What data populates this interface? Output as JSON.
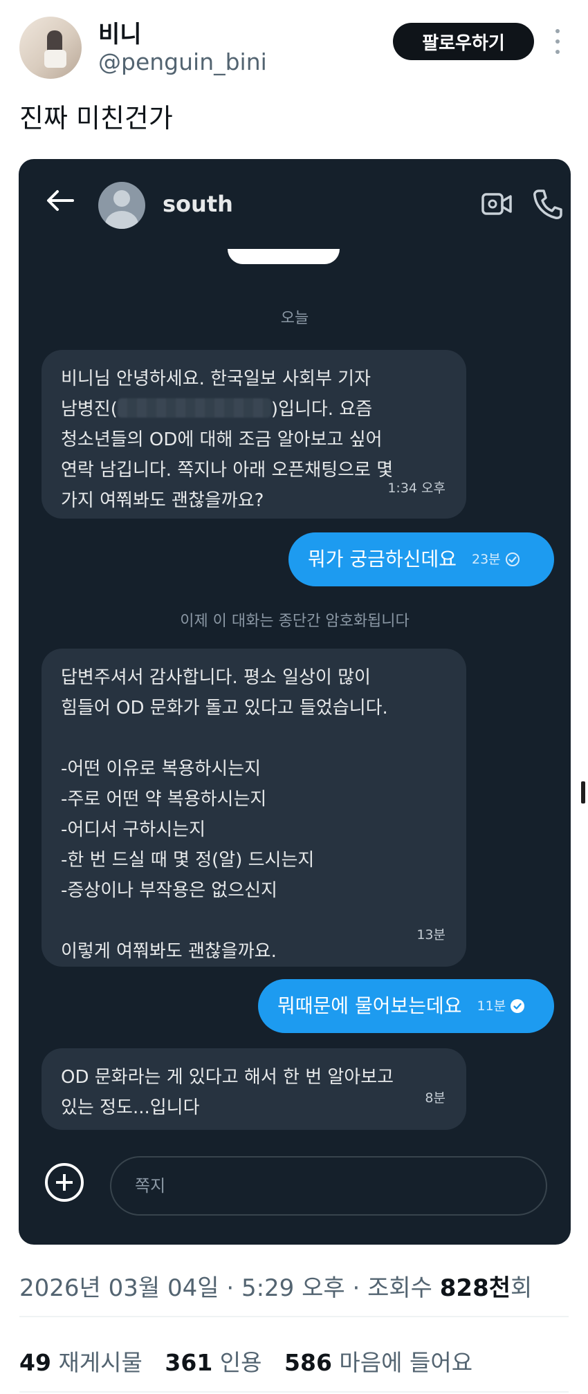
{
  "tweet": {
    "author": {
      "display_name": "비니",
      "handle": "@penguin_bini"
    },
    "follow_label": "팔로우하기",
    "text": "진짜 미친건가"
  },
  "dm": {
    "contact_name": "south",
    "day_label": "오늘",
    "system_note": "이제 이 대화는 종단간 암호화됩니다",
    "messages": [
      {
        "from": "them",
        "lines": [
          "비니님 안녕하세요. 한국일보 사회부 기자",
          "남병진(",
          ")입니다. 요즘",
          "청소년들의 OD에 대해 조금 알아보고 싶어",
          "연락 남깁니다. 쪽지나 아래 오픈채팅으로 몇",
          "가지 여쭤봐도 괜찮을까요?"
        ],
        "time": "1:34 오후"
      },
      {
        "from": "me",
        "text": "뭐가 궁금하신데요",
        "time": "23분"
      },
      {
        "from": "them",
        "text": "답변주셔서 감사합니다. 평소 일상이 많이\n힘들어 OD 문화가 돌고 있다고 들었습니다.\n\n-어떤 이유로 복용하시는지\n-주로 어떤 약 복용하시는지\n-어디서 구하시는지\n-한 번 드실 때 몇 정(알) 드시는지\n-증상이나 부작용은 없으신지\n\n이렇게 여쭤봐도 괜찮을까요.",
        "time": "13분"
      },
      {
        "from": "me",
        "text": "뭐때문에 물어보는데요",
        "time": "11분"
      },
      {
        "from": "them",
        "text": "OD 문화라는 게 있다고 해서 한 번 알아보고\n있는 정도...입니다",
        "time": "8분"
      }
    ],
    "compose_placeholder": "쪽지"
  },
  "footer": {
    "date": "2026년 03월 04일",
    "time": "5:29 오후",
    "views_label": "조회수",
    "views_count": "828천",
    "views_suffix": "회",
    "reposts_count": "49",
    "reposts_label": "재게시물",
    "quotes_count": "361",
    "quotes_label": "인용",
    "likes_count": "586",
    "likes_label": "마음에 들어요"
  },
  "icons": {
    "back": "arrow-left-icon",
    "video": "video-camera-icon",
    "call": "phone-icon",
    "add": "plus-circle-icon",
    "more": "more-vertical-icon",
    "read": "check-circle-icon"
  },
  "colors": {
    "dm_bg": "#15202b",
    "incoming_bubble": "#273340",
    "outgoing_bubble": "#1d9bf0",
    "follow_btn": "#0f1419"
  }
}
